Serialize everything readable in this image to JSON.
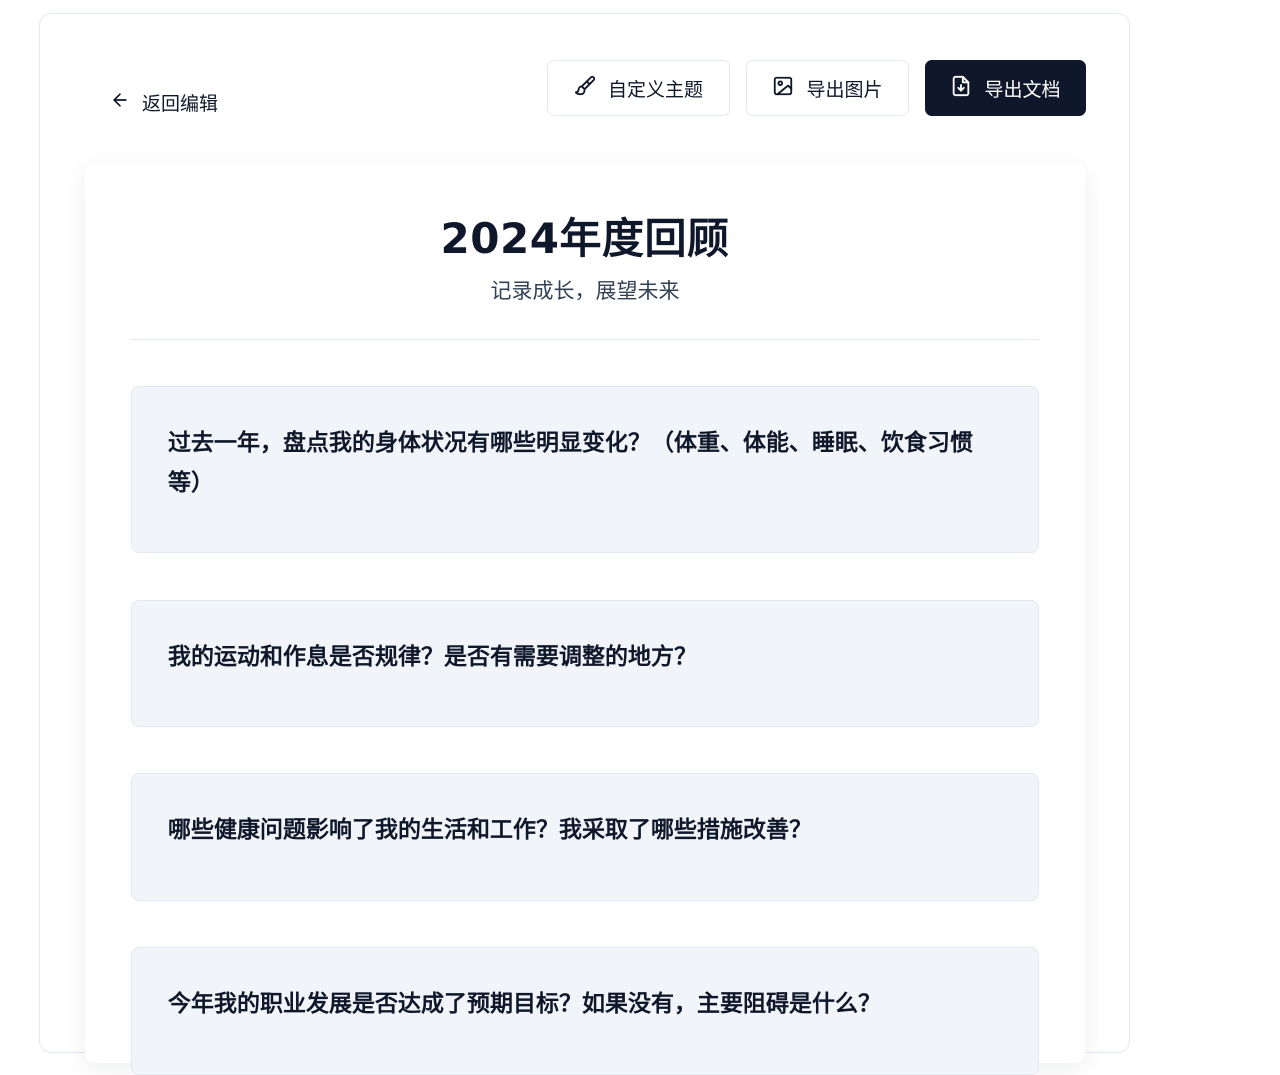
{
  "toolbar": {
    "back_label": "返回编辑",
    "custom_theme_label": "自定义主题",
    "export_image_label": "导出图片",
    "export_doc_label": "导出文档"
  },
  "icons": {
    "back": "arrow-left-icon",
    "custom_theme": "paintbrush-icon",
    "export_image": "image-icon",
    "export_doc": "file-download-icon"
  },
  "document": {
    "title": "2024年度回顾",
    "subtitle": "记录成长，展望未来",
    "questions": [
      {
        "text": "过去一年，盘点我的身体状况有哪些明显变化？（体重、体能、睡眠、饮食习惯等）"
      },
      {
        "text": "我的运动和作息是否规律？是否有需要调整的地方？"
      },
      {
        "text": "哪些健康问题影响了我的生活和工作？我采取了哪些措施改善？"
      },
      {
        "text": "今年我的职业发展是否达成了预期目标？如果没有，主要阻碍是什么？"
      }
    ]
  },
  "colors": {
    "primary_dark": "#0f172a",
    "card_bg": "#f1f5f9",
    "border": "#e2e8f0"
  }
}
